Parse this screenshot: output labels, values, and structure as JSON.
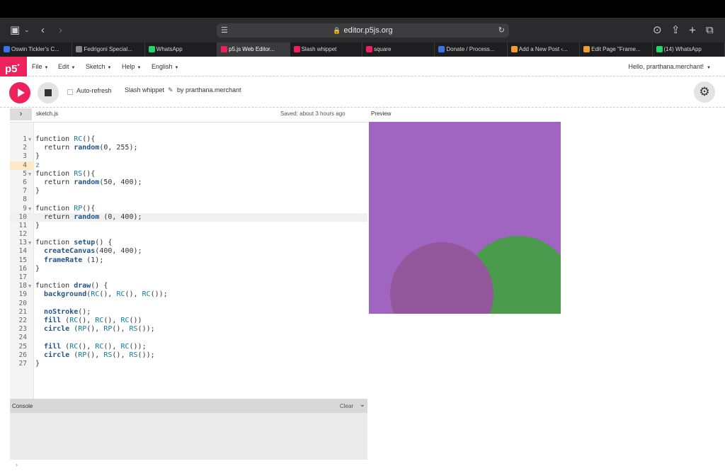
{
  "browser": {
    "url": "editor.p5js.org"
  },
  "tabs": [
    {
      "label": "Oswin Tickler's C...",
      "icon_color": "#3b73e6"
    },
    {
      "label": "Fedrigoni Special...",
      "icon_color": "#888888"
    },
    {
      "label": "WhatsApp",
      "icon_color": "#25d366"
    },
    {
      "label": "p5.js Web Editor...",
      "icon_color": "#ed225d",
      "active": true
    },
    {
      "label": "Slash whippet",
      "icon_color": "#ed225d"
    },
    {
      "label": "square",
      "icon_color": "#ed225d"
    },
    {
      "label": "Donate / Process...",
      "icon_color": "#3b73e6"
    },
    {
      "label": "Add a New Post ‹...",
      "icon_color": "#f0a030"
    },
    {
      "label": "Edit Page \"Frame...",
      "icon_color": "#f0a030"
    },
    {
      "label": "(14) WhatsApp",
      "icon_color": "#25d366"
    }
  ],
  "app": {
    "logo": "p5",
    "logo_sup": "*",
    "menu": [
      "File",
      "Edit",
      "Sketch",
      "Help",
      "English"
    ],
    "user_greeting": "Hello, prarthana.merchant!",
    "auto_refresh_label": "Auto-refresh",
    "sketch_name": "Slash whippet",
    "byline": "by prarthana.merchant",
    "file_name": "sketch.js",
    "saved_status": "Saved: about 3 hours ago",
    "preview_label": "Preview",
    "console_title": "Console",
    "console_clear": "Clear",
    "accent_color": "#ed225d"
  },
  "code_lines": [
    "function RC(){",
    "  return random(0, 255);",
    "}",
    "z",
    "function RS(){",
    "  return random(50, 400);",
    "}",
    "",
    "function RP(){",
    "  return random (0, 400);",
    "}",
    "",
    "function setup() {",
    "  createCanvas(400, 400);",
    "  frameRate (1);",
    "}",
    "",
    "function draw() {",
    "  background(RC(), RC(), RC());",
    "",
    "  noStroke();",
    "  fill (RC(), RC(), RC())",
    "  circle (RP(), RP(), RS());",
    "",
    "  fill (RC(), RC(), RC());",
    "  circle (RP(), RS(), RS());",
    "}"
  ],
  "preview": {
    "background": "#9f65c0",
    "circles": [
      {
        "color": "#4a9b4b"
      },
      {
        "color": "#93579c"
      }
    ]
  }
}
